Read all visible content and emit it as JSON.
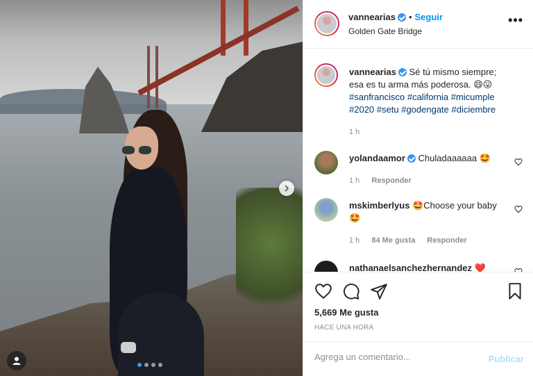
{
  "post": {
    "username": "vannearias",
    "follow_label": "Seguir",
    "location": "Golden Gate Bridge",
    "caption_prefix": "Sé tú mismo siempre; esa es tu arma más poderosa. 😄😛",
    "hashtags": [
      "#sanfrancisco",
      "#california",
      "#micumple",
      "#2020",
      "#setu",
      "#godengate",
      "#diciembre"
    ],
    "caption_time": "1 h",
    "carousel_slides": 4,
    "carousel_active": 1
  },
  "comments": [
    {
      "username": "yolandaamor",
      "verified": true,
      "text": "Chuladaaaaaa 🤩",
      "time": "1 h",
      "reply_label": "Responder"
    },
    {
      "username": "mskimberlyus",
      "verified": false,
      "text": "🤩Choose your baby🤩",
      "time": "1 h",
      "likes": "84 Me gusta",
      "reply_label": "Responder"
    },
    {
      "username": "nathanaelsanchezhernandez",
      "verified": false,
      "text": "❤️"
    }
  ],
  "actions": {
    "likes": "5,669 Me gusta",
    "posted": "HACE UNA HORA"
  },
  "comment_form": {
    "placeholder": "Agrega un comentario...",
    "publish_label": "Publicar"
  },
  "icons": {
    "more": "more-options-icon",
    "verified": "verified-badge-icon",
    "like": "heart-icon",
    "comment": "comment-icon",
    "share": "share-icon",
    "save": "bookmark-icon",
    "next": "chevron-right-icon",
    "tag": "user-tag-icon"
  },
  "colors": {
    "accent": "#0095f6",
    "publish_disabled": "#b2dffc",
    "hashtag": "#00376b",
    "muted": "#8e8e8e"
  }
}
